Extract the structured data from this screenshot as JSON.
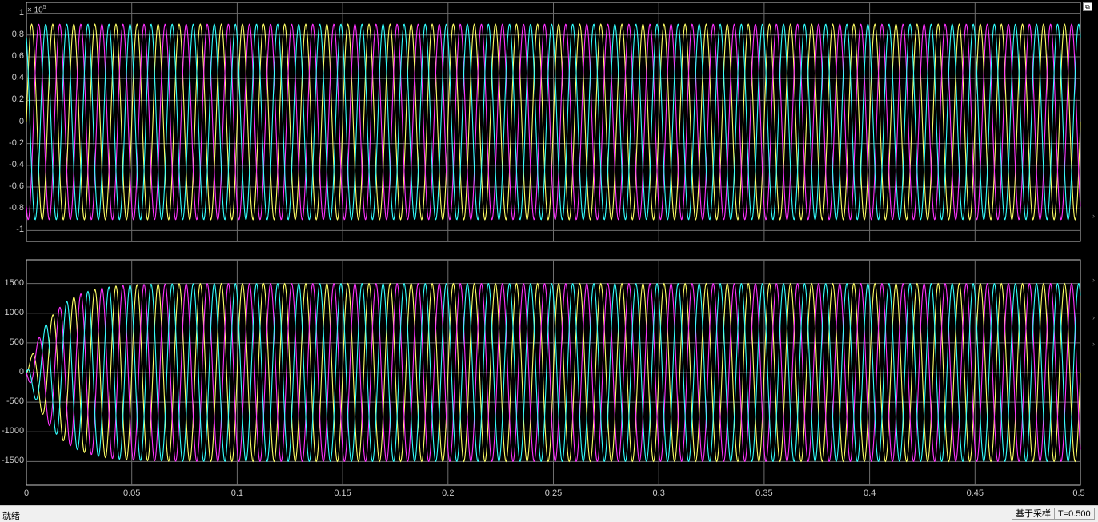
{
  "window": {
    "restore_icon": "restore-icon"
  },
  "plots": [
    {
      "exponent_base": "× 10",
      "exponent_power": "5",
      "yticks": [
        "1",
        "0.8",
        "0.6",
        "0.4",
        "0.2",
        "0",
        "-0.2",
        "-0.4",
        "-0.6",
        "-0.8",
        "-1"
      ],
      "xticks": []
    },
    {
      "yticks": [
        "1500",
        "1000",
        "500",
        "0",
        "-500",
        "-1000",
        "-1500"
      ],
      "xticks": [
        "0",
        "0.05",
        "0.1",
        "0.15",
        "0.2",
        "0.25",
        "0.3",
        "0.35",
        "0.4",
        "0.45",
        "0.5"
      ]
    }
  ],
  "chart_data": [
    {
      "type": "line",
      "x_range": [
        0,
        0.5
      ],
      "ylim": [
        -1.1,
        1.1
      ],
      "y_scale_note": "× 10^5",
      "grid": true,
      "series": [
        {
          "color": "#ffff66",
          "amplitude": 0.9,
          "frequency_hz": 100,
          "phase_deg": 0,
          "offset": 0
        },
        {
          "color": "#ff33ff",
          "amplitude": 0.9,
          "frequency_hz": 100,
          "phase_deg": -120,
          "offset": 0
        },
        {
          "color": "#33ffff",
          "amplitude": 0.9,
          "frequency_hz": 100,
          "phase_deg": 120,
          "offset": 0
        }
      ],
      "background": "#000000",
      "grid_color": "#6e6e6e"
    },
    {
      "type": "line",
      "x_range": [
        0,
        0.5
      ],
      "ylim": [
        -1900,
        1900
      ],
      "grid": true,
      "steady_amplitude": 1500,
      "rise_time_constant_s": 0.012,
      "series": [
        {
          "color": "#ffff66",
          "frequency_hz": 100,
          "phase_deg": 0
        },
        {
          "color": "#ff33ff",
          "frequency_hz": 100,
          "phase_deg": -120
        },
        {
          "color": "#33ffff",
          "frequency_hz": 100,
          "phase_deg": 120
        }
      ],
      "background": "#000000",
      "grid_color": "#6e6e6e"
    }
  ],
  "status": {
    "text": "就绪",
    "mode": "基于采样",
    "time": "T=0.500"
  }
}
